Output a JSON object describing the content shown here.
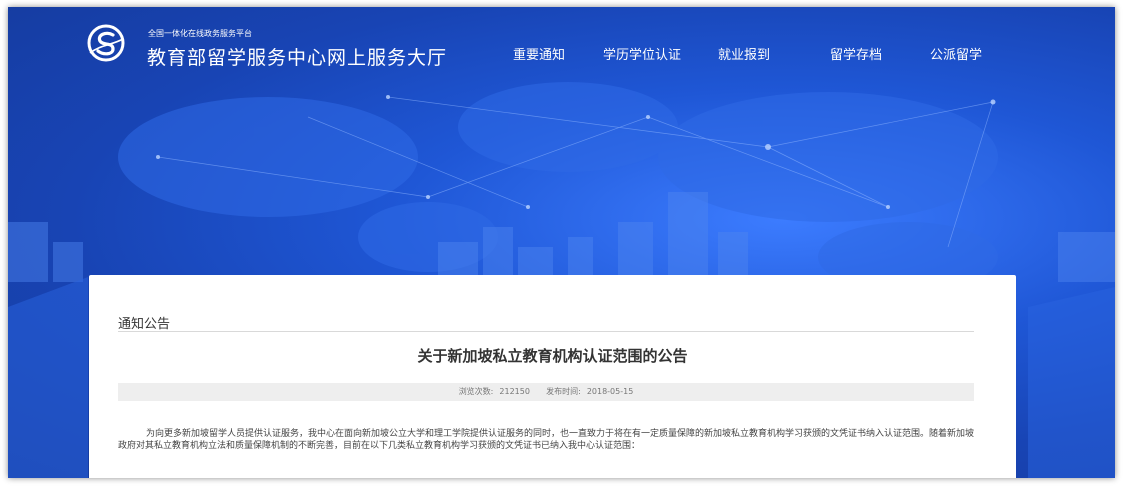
{
  "header": {
    "logo": "csc-logo-icon",
    "subtitle": "全国一体化在线政务服务平台",
    "title": "教育部留学服务中心网上服务大厅"
  },
  "nav": {
    "items": [
      {
        "label": "重要通知"
      },
      {
        "label": "学历学位认证"
      },
      {
        "label": "就业报到"
      },
      {
        "label": "留学存档"
      },
      {
        "label": "公派留学"
      }
    ]
  },
  "article": {
    "section": "通知公告",
    "title": "关于新加坡私立教育机构认证范围的公告",
    "views_label": "浏览次数:",
    "views": "212150",
    "date_label": "发布时间:",
    "date": "2018-05-15",
    "body": "为向更多新加坡留学人员提供认证服务，我中心在面向新加坡公立大学和理工学院提供认证服务的同时，也一直致力于将在有一定质量保障的新加坡私立教育机构学习获颁的文凭证书纳入认证范围。随着新加坡政府对其私立教育机构立法和质量保障机制的不断完善，目前在以下几类私立教育机构学习获颁的文凭证书已纳入我中心认证范围："
  },
  "colors": {
    "hero_blue": "#1f57d6",
    "text": "#333333"
  }
}
